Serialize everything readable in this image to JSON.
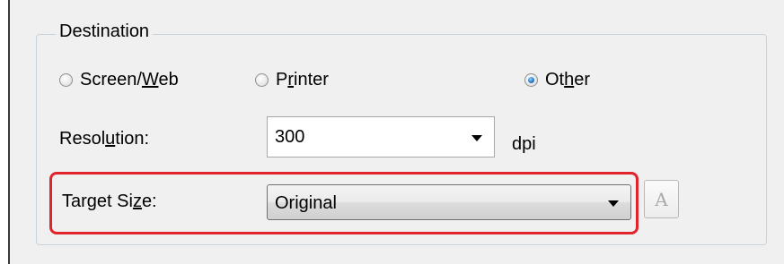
{
  "destination": {
    "title": "Destination",
    "options": [
      {
        "pre": "Screen/",
        "ul": "W",
        "post": "eb",
        "checked": false
      },
      {
        "pre": "P",
        "ul": "r",
        "post": "inter",
        "checked": false
      },
      {
        "pre": "Ot",
        "ul": "h",
        "post": "er",
        "checked": true
      }
    ]
  },
  "resolution": {
    "label_pre": "Resol",
    "label_ul": "u",
    "label_post": "tion:",
    "value": "300",
    "unit": "dpi"
  },
  "target_size": {
    "label_pre": "Target Si",
    "label_ul": "z",
    "label_post": "e:",
    "value": "Original",
    "icon": "text-orientation-icon",
    "icon_glyph": "A"
  },
  "colors": {
    "highlight": "#e1242b",
    "radio_checked": "#2a7cc8"
  }
}
